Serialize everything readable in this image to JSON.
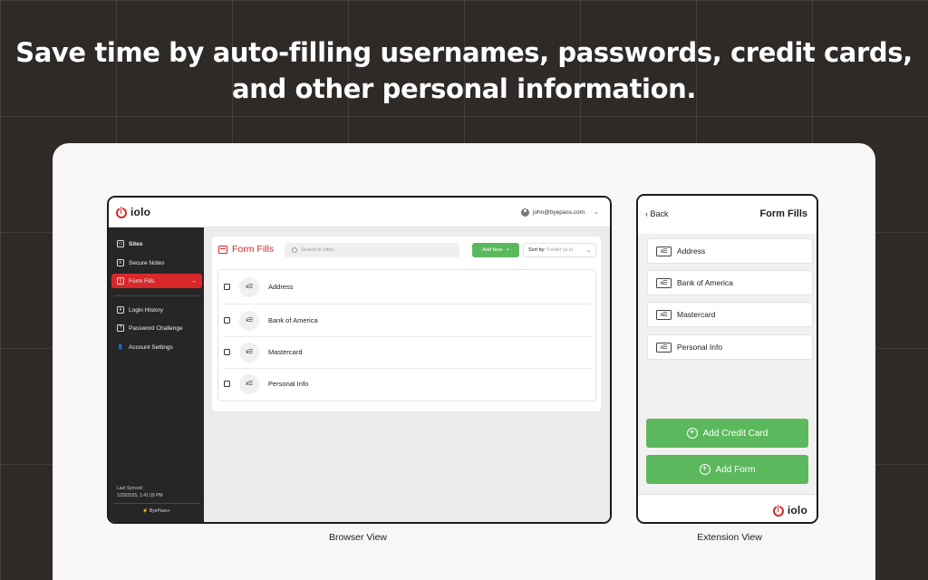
{
  "headline": {
    "line1": "Save time by auto-filling usernames, passwords, credit cards,",
    "line2": "and other personal information."
  },
  "colors": {
    "brand_red": "#d8282b",
    "green": "#5cb85c",
    "sidebar": "#262626",
    "background": "#2e2a28"
  },
  "browser": {
    "logo_text": "iolo",
    "user_email": "john@byepass.com",
    "sidebar": {
      "items": [
        {
          "label": "Sites",
          "icon": "sites-icon"
        },
        {
          "label": "Secure Notes",
          "icon": "notes-icon"
        },
        {
          "label": "Form Fills",
          "icon": "form-fills-icon",
          "active": true
        },
        {
          "label": "Login History",
          "icon": "history-icon"
        },
        {
          "label": "Password Challenge",
          "icon": "challenge-icon"
        },
        {
          "label": "Account Settings",
          "icon": "user-icon"
        }
      ],
      "last_synced_label": "Last Synced:",
      "last_synced_value": "1/29/2025, 1:41:39 PM",
      "footer_brand": "ByePass+"
    },
    "main": {
      "title": "Form Fills",
      "search_placeholder": "Search in sites...",
      "add_new_label": "Add New",
      "sort_label": "Sort by:",
      "sort_value": "Folder (a-z)",
      "rows": [
        "Address",
        "Bank of America",
        "Mastercard",
        "Personal Info"
      ]
    }
  },
  "extension": {
    "back_label": "Back",
    "title": "Form Fills",
    "items": [
      "Address",
      "Bank of America",
      "Mastercard",
      "Personal Info"
    ],
    "add_credit_card_label": "Add Credit Card",
    "add_form_label": "Add Form",
    "logo_text": "iolo"
  },
  "captions": {
    "browser": "Browser View",
    "extension": "Extension View"
  }
}
